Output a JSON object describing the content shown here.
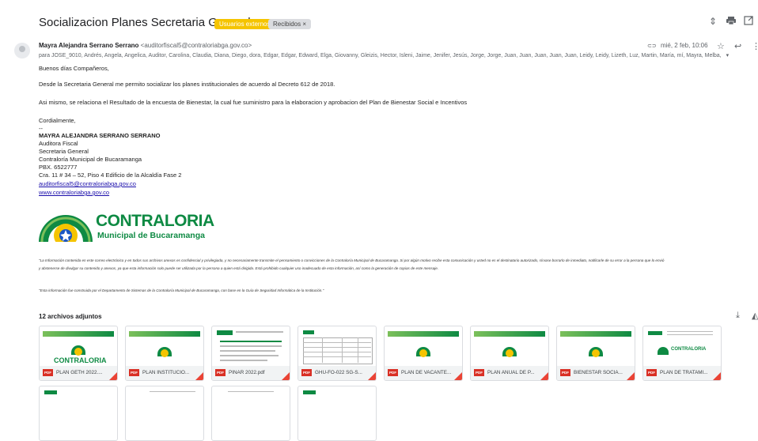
{
  "email": {
    "subject": "Socializacion Planes Secretaria General",
    "labels": [
      "Usuarios externos",
      "Recibidos ×"
    ],
    "sender_name": "Mayra Alejandra Serrano Serrano",
    "sender_email": "<auditorfiscal5@contraloriabga.gov.co>",
    "recipients": "para JOSE_9010, Andrés, Angela, Angelica, Auditor, Carolina, Claudia, Diana, Diego, dora, Edgar, Edgar, Edward, Elga, Giovanny, Gleizis, Hector, Isleni, Jaime, Jenifer, Jesús, Jorge, Jorge, Juan, Juan, Juan, Juan, Juan, Leidy, Leidy, Lizeth, Luz, Martin, María, mí, Mayra, Melba,",
    "date": "mié, 2 feb, 10:06",
    "greeting": "Buenos días Compañeros,",
    "para1": "Desde la Secretaria General me permito socializar los planes institucionales de acuerdo al Decreto 612 de 2018.",
    "para2": "Asi mismo, se relaciona el Resultado de la encuesta de Bienestar, la cual fue suministro para la elaboracion y aprobacion del Plan de Bienestar Social e Incentivos",
    "closing": "Cordialmente,",
    "dash": "--",
    "sig_name": "MAYRA ALEJANDRA SERRANO SERRANO",
    "sig_lines": [
      "Auditora Fiscal",
      "Secretaria General",
      "Contraloría Municipal de Bucaramanga",
      "PBX. 6522777",
      "Cra. 11 # 34 – 52, Piso 4 Edificio de la Alcaldía Fase 2"
    ],
    "sig_email": "auditorfiscal5@contraloriabga.gov.co",
    "sig_web": "www.contraloriabga.gov.co",
    "logo_line1": "CONTRALORIA",
    "logo_line2": "Municipal de Bucaramanga",
    "disclaimer1": "\"La Información contenida en este correo electrónico y en todos sus archivos anexos es confidencial y privilegiada, y no necesariamente transmite el pensamiento o convicciones de la Contraloría Municipal de Bucaramanga.  Si por algún motivo recibe esta comunicación y usted no es el destinatario autorizado, sírvase borrarlo de inmediato, notificarle de su error a la persona que lo envió",
    "disclaimer2": "y abstenerse de divulgar su contenido y anexos, ya que esta información solo puede ser utilizada por la persona a quien está dirigida. Está prohibido cualquier uso inadecuado de esta información, así como la generación de copias de este mensaje.",
    "disclaimer3": "\"Esta información fue construida por el Departamento de Sistemas de la Contraloría Municipal de Bucaramanga, con base en la Guía de Seguridad Informática de la Institución.\""
  },
  "attachments": {
    "title": "12 archivos adjuntos",
    "pdf_badge": "PDF",
    "thumb_logo_text": "CONTRALORIA",
    "files": [
      "PLAN GETH 2022....",
      "PLAN INSTITUCIO...",
      "PINAR 2022.pdf",
      "GHU-FO-022 SG-S...",
      "PLAN DE VACANTE...",
      "PLAN ANUAL DE P...",
      "BIENESTAR SOCIA...",
      "PLAN DE TRATAMI..."
    ]
  },
  "icons": [
    "up-down-icon",
    "print-icon",
    "open-new-icon",
    "star-icon",
    "reply-icon",
    "more-icon",
    "download-icon",
    "drive-icon",
    "chevron-down-icon"
  ],
  "colors": {
    "brand_green": "#0e8a43",
    "brand_yellow": "#f5c400",
    "link": "#1a0dab",
    "pdf_red": "#d93025"
  }
}
